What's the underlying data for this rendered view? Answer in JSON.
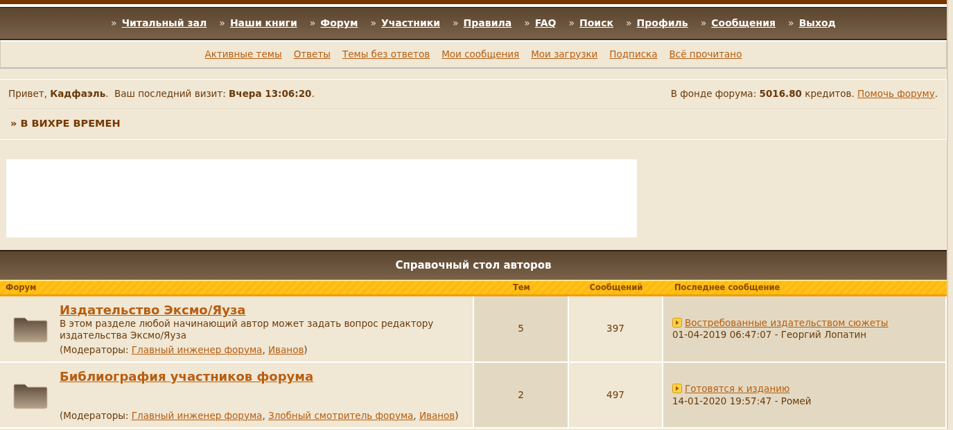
{
  "top_nav": [
    {
      "marker": "»",
      "label": "Читальный зал"
    },
    {
      "marker": "»",
      "label": "Наши книги"
    },
    {
      "marker": "»",
      "label": "Форум"
    },
    {
      "marker": "»",
      "label": "Участники"
    },
    {
      "marker": "»",
      "label": "Правила"
    },
    {
      "marker": "»",
      "label": "FAQ"
    },
    {
      "marker": "»",
      "label": "Поиск"
    },
    {
      "marker": "»",
      "label": "Профиль"
    },
    {
      "marker": "»",
      "label": "Сообщения"
    },
    {
      "marker": "»",
      "label": "Выход"
    }
  ],
  "sub_nav": [
    "Активные темы",
    "Ответы",
    "Темы без ответов",
    "Мои сообщения",
    "Мои загрузки",
    "Подписка",
    "Всё прочитано"
  ],
  "welcome": {
    "greeting": "Привет, **Кадфаэль**.  Ваш последний визит: **Вчера 13:06:20**.",
    "fund": "В фонде форума: **5016.80** кредитов. ",
    "fund_link": "Помочь форуму",
    "fund_end": "."
  },
  "breadcrumb": "» В ВИХРЕ ВРЕМЕН",
  "category": {
    "title": "Справочный стол авторов",
    "columns": [
      "Форум",
      "Тем",
      "Сообщений",
      "Последнее сообщение"
    ],
    "forums": [
      {
        "title": "Издательство Эксмо/Яуза",
        "description": "В этом разделе любой начинающий автор может задать вопрос редактору издательства Эксмо/Яуза",
        "moderators_label": "(Модераторы: ",
        "moderators": [
          "Главный инженер форума",
          "Иванов"
        ],
        "moderators_separator": ", ",
        "moderators_end": ")",
        "topics": "5",
        "posts": "397",
        "last_post": {
          "title": "Востребованные издательством сюжеты",
          "meta": "01-04-2019 06:47:07 - Георгий Лопатин"
        }
      },
      {
        "title": "Библиография участников форума",
        "moderators_label": "(Модераторы: ",
        "moderators": [
          "Главный инженер форума",
          "Злобный смотритель форума",
          "Иванов"
        ],
        "moderators_separator": ", ",
        "moderators_end": ")",
        "topics": "2",
        "posts": "497",
        "last_post": {
          "title": "Готовятся к изданию",
          "meta": "14-01-2020 19:57:47 - Ромей"
        }
      }
    ]
  }
}
